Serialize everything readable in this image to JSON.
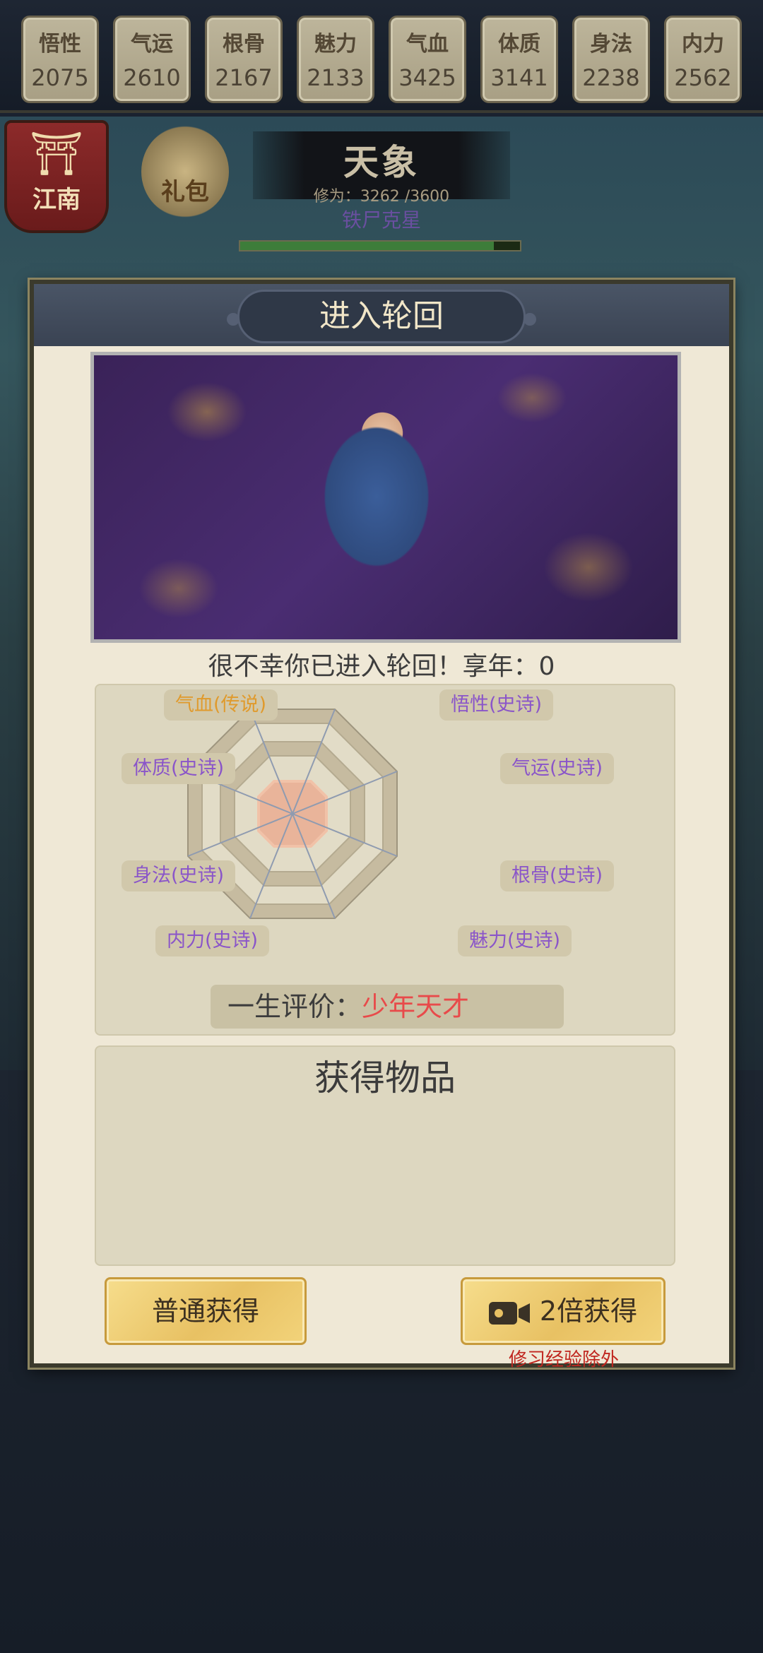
{
  "stats": [
    {
      "name": "悟性",
      "value": "2075"
    },
    {
      "name": "气运",
      "value": "2610"
    },
    {
      "name": "根骨",
      "value": "2167"
    },
    {
      "name": "魅力",
      "value": "2133"
    },
    {
      "name": "气血",
      "value": "3425"
    },
    {
      "name": "体质",
      "value": "3141"
    },
    {
      "name": "身法",
      "value": "2238"
    },
    {
      "name": "内力",
      "value": "2562"
    }
  ],
  "location": "江南",
  "gift_label": "礼包",
  "realm": {
    "name": "天象",
    "cultivation_text": "修为：3262 /3600",
    "cultivation_current": 3262,
    "cultivation_max": 3600,
    "subtitle": "铁尸克星"
  },
  "modal": {
    "title": "进入轮回",
    "message": "很不幸你已进入轮回！享年：0",
    "attributes": {
      "qixue": "气血(传说)",
      "wuxing": "悟性(史诗)",
      "qiyun": "气运(史诗)",
      "gengu": "根骨(史诗)",
      "meili": "魅力(史诗)",
      "neili": "内力(史诗)",
      "shenfa": "身法(史诗)",
      "tizhi": "体质(史诗)"
    },
    "rating_label": "一生评价：",
    "rating_value": "少年天才",
    "items_title": "获得物品",
    "btn_normal": "普通获得",
    "btn_double": "2倍获得",
    "note": "修习经验除外"
  },
  "colors": {
    "epic": "#8a55c9",
    "legendary": "#e09a2c",
    "rating": "#e84a4a"
  }
}
